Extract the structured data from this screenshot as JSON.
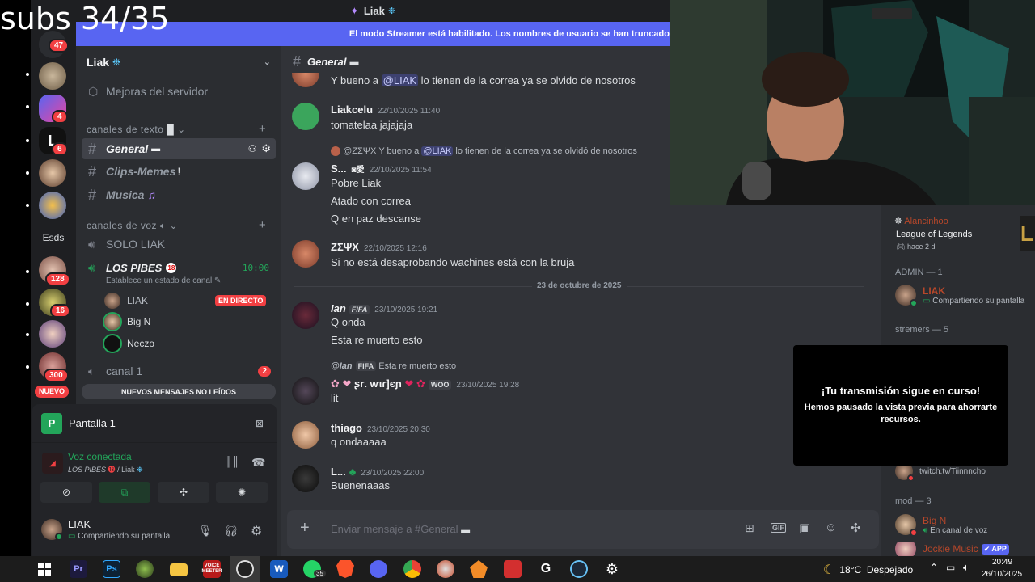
{
  "overlay_text": "subs 34/35",
  "window": {
    "title": "Liak"
  },
  "banner": "El modo Streamer está habilitado. Los nombres de usuario se han truncado",
  "rail": {
    "badges": [
      "47",
      "4",
      "6",
      "128",
      "16",
      "300"
    ],
    "label_esds": "Esds",
    "nuevo": "NUEVO"
  },
  "server": {
    "name": "Liak",
    "boost_item": "Mejoras del servidor",
    "text_category": "canales de texto",
    "text_channels": [
      {
        "name": "General"
      },
      {
        "name": "Clips-Memes"
      },
      {
        "name": "Musica"
      }
    ],
    "voice_category": "canales de voz",
    "voice_channels": {
      "solo": "SOLO LIAK",
      "pibes": "LOS PIBES",
      "pibes_timer": "10:00",
      "pibes_status": "Establece un estado de canal",
      "canal1": "canal 1",
      "canal1_badge": "2"
    },
    "voice_users": [
      {
        "name": "LIAK",
        "badge": "EN DIRECTO"
      },
      {
        "name": "Big N"
      },
      {
        "name": "Neczo"
      }
    ],
    "unread_pill": "NUEVOS MENSAJES NO LEÍDOS"
  },
  "panel": {
    "screen_title": "Pantalla 1",
    "voice_status": "Voz conectada",
    "voice_location": "LOS PIBES",
    "voice_location_sub": "/ Liak",
    "user_name": "LIAK",
    "user_status": "Compartiendo su pantalla"
  },
  "chat": {
    "channel_name": "General",
    "top_partial": {
      "prefix": "Y bueno a ",
      "mention": "@LIAK",
      "suffix": " lo tienen de la correa ya se olvido de nosotros"
    },
    "messages": [
      {
        "author": "Liakcelu",
        "time": "22/10/2025 11:40",
        "lines": [
          "tomatelaa jajajaja"
        ]
      },
      {
        "reply_author": "@ΖΣΨΧ",
        "reply_prefix": "Y bueno a ",
        "reply_mention": "@LIAK",
        "reply_suffix": " lo tienen de la correa ya se olvidó de nosotros",
        "author": "S...",
        "time": "22/10/2025 11:54",
        "lines": [
          "Pobre Liak",
          "Atado con correa",
          "Q en paz descanse"
        ]
      },
      {
        "author": "ΖΣΨΧ",
        "time": "22/10/2025 12:16",
        "lines": [
          "Si no está desaprobando wachines está con la bruja"
        ]
      },
      {
        "author": "Ian",
        "tag": "FIFA",
        "time": "23/10/2025 19:21",
        "lines": [
          "Q onda",
          "Esta re muerto esto"
        ]
      },
      {
        "reply_author": "@Ian",
        "reply_tag": "FIFA",
        "reply_text": "Esta re muerto esto",
        "author": "ʂɾ. ⱳιɾ]єɲ",
        "tag": "WOO",
        "time": "23/10/2025 19:28",
        "lines": [
          "lit"
        ]
      },
      {
        "author": "thiago",
        "time": "23/10/2025 20:30",
        "lines": [
          "q ondaaaaa"
        ]
      },
      {
        "author": "L...",
        "time": "23/10/2025 22:00",
        "lines": [
          "Buenenaaas"
        ]
      }
    ],
    "date_divider": "23 de octubre de 2025",
    "composer_placeholder": "Enviar mensaje a #General"
  },
  "members": {
    "activity_user": "Alancinhoo",
    "activity_game": "League of Legends",
    "activity_time": "hace 2 d",
    "admin_header": "ADMIN — 1",
    "admin": {
      "name": "LIAK",
      "status": "Compartiendo su pantalla"
    },
    "streamers_header": "stremers — 5",
    "streamer_sub": "twitch.tv/Tiinnncho",
    "mod_header": "mod — 3",
    "mods": [
      {
        "name": "Big N",
        "status": "En canal de voz"
      },
      {
        "name": "Jockie Music",
        "tag": "APP"
      }
    ]
  },
  "stream_overlay": {
    "title": "¡Tu transmisión sigue en curso!",
    "body": "Hemos pausado la vista previa para ahorrarte recursos."
  },
  "taskbar": {
    "whatsapp_count": "35",
    "weather": "18°C  Despejado",
    "clock_time": "20:49",
    "clock_date": "26/10/2025"
  },
  "colors": {
    "accent": "#5865f2",
    "danger": "#f23f42",
    "online": "#23a55a",
    "background": "#313338"
  }
}
